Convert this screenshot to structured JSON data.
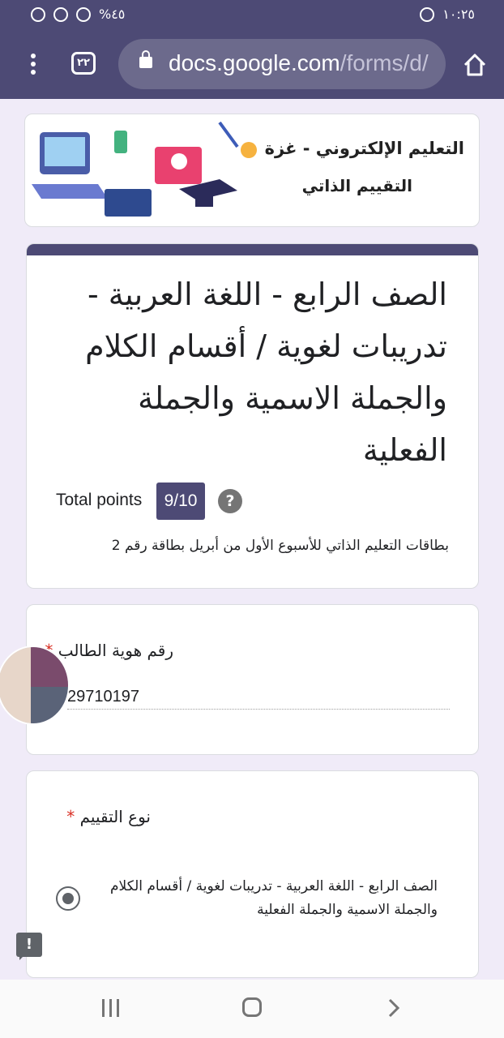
{
  "status_bar": {
    "time": "١٠:٢٥",
    "battery": "%٤٥"
  },
  "browser": {
    "tab_count": "٢٢",
    "url_host": "docs.google.com",
    "url_path": "/forms/d/"
  },
  "banner": {
    "title": "التعليم الإلكتروني - غزة",
    "subtitle": "التقييم الذاتي"
  },
  "form": {
    "title": "الصف الرابع - اللغة العربية - تدريبات لغوية / أقسام الكلام والجملة الاسمية والجملة الفعلية",
    "points_label": "Total points",
    "points_value": "9/10",
    "help_symbol": "?",
    "description": "بطاقات التعليم الذاتي للأسبوع الأول من أبريل بطاقة رقم 2"
  },
  "questions": [
    {
      "label": "رقم هوية الطالب",
      "required_mark": "*",
      "answer": "29710197"
    },
    {
      "label": "نوع التقييم",
      "required_mark": "*",
      "option_text": "الصف الرابع - اللغة العربية - تدريبات لغوية / أقسام الكلام والجملة الاسمية والجملة الفعلية",
      "option_selected": true
    }
  ],
  "feedback_symbol": "!",
  "colors": {
    "theme": "#4d4a75",
    "background": "#f0ebf8",
    "required": "#d93025"
  },
  "icons": [
    "menu-dots-icon",
    "lock-icon",
    "home-icon",
    "help-icon",
    "feedback-icon",
    "recent-apps-icon",
    "nav-home-icon",
    "back-icon"
  ]
}
